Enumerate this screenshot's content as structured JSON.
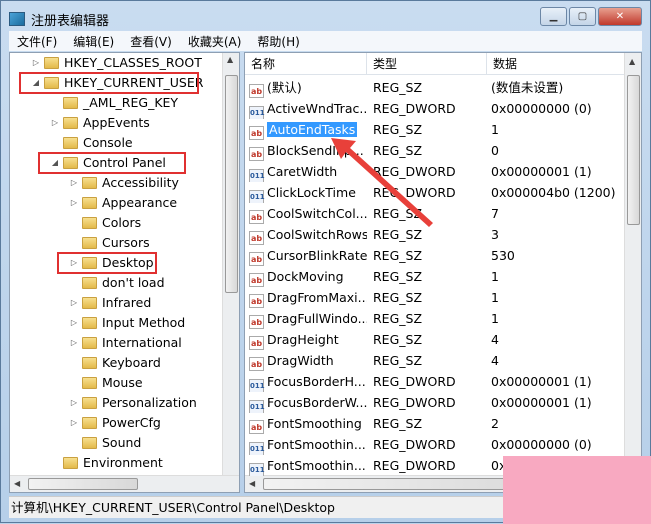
{
  "window": {
    "title": "注册表编辑器",
    "buttons": [
      "minimize",
      "maximize",
      "close"
    ]
  },
  "menu": [
    "文件(F)",
    "编辑(E)",
    "查看(V)",
    "收藏夹(A)",
    "帮助(H)"
  ],
  "tree": [
    {
      "label": "HKEY_CLASSES_ROOT",
      "level": 0,
      "expander": "collapsed"
    },
    {
      "label": "HKEY_CURRENT_USER",
      "level": 0,
      "expander": "expanded",
      "highlighted": true
    },
    {
      "label": "_AML_REG_KEY",
      "level": 1,
      "expander": "none"
    },
    {
      "label": "AppEvents",
      "level": 1,
      "expander": "collapsed"
    },
    {
      "label": "Console",
      "level": 1,
      "expander": "none"
    },
    {
      "label": "Control Panel",
      "level": 1,
      "expander": "expanded",
      "highlighted": true
    },
    {
      "label": "Accessibility",
      "level": 2,
      "expander": "collapsed"
    },
    {
      "label": "Appearance",
      "level": 2,
      "expander": "collapsed"
    },
    {
      "label": "Colors",
      "level": 2,
      "expander": "none"
    },
    {
      "label": "Cursors",
      "level": 2,
      "expander": "none"
    },
    {
      "label": "Desktop",
      "level": 2,
      "expander": "collapsed",
      "highlighted": true,
      "selected": true
    },
    {
      "label": "don't load",
      "level": 2,
      "expander": "none"
    },
    {
      "label": "Infrared",
      "level": 2,
      "expander": "collapsed"
    },
    {
      "label": "Input Method",
      "level": 2,
      "expander": "collapsed"
    },
    {
      "label": "International",
      "level": 2,
      "expander": "collapsed"
    },
    {
      "label": "Keyboard",
      "level": 2,
      "expander": "none"
    },
    {
      "label": "Mouse",
      "level": 2,
      "expander": "none"
    },
    {
      "label": "Personalization",
      "level": 2,
      "expander": "collapsed"
    },
    {
      "label": "PowerCfg",
      "level": 2,
      "expander": "collapsed"
    },
    {
      "label": "Sound",
      "level": 2,
      "expander": "none"
    },
    {
      "label": "Environment",
      "level": 1,
      "expander": "none"
    }
  ],
  "list": {
    "columns": [
      "名称",
      "类型",
      "数据"
    ],
    "rows": [
      {
        "icon": "string",
        "name": "(默认)",
        "type": "REG_SZ",
        "data": "(数值未设置)"
      },
      {
        "icon": "dword",
        "name": "ActiveWndTrac...",
        "type": "REG_DWORD",
        "data": "0x00000000 (0)"
      },
      {
        "icon": "string",
        "name": "AutoEndTasks",
        "type": "REG_SZ",
        "data": "1",
        "selected": true
      },
      {
        "icon": "string",
        "name": "BlockSendInp...",
        "type": "REG_SZ",
        "data": "0"
      },
      {
        "icon": "dword",
        "name": "CaretWidth",
        "type": "REG_DWORD",
        "data": "0x00000001 (1)"
      },
      {
        "icon": "dword",
        "name": "ClickLockTime",
        "type": "REG_DWORD",
        "data": "0x000004b0 (1200)"
      },
      {
        "icon": "string",
        "name": "CoolSwitchCol...",
        "type": "REG_SZ",
        "data": "7"
      },
      {
        "icon": "string",
        "name": "CoolSwitchRows",
        "type": "REG_SZ",
        "data": "3"
      },
      {
        "icon": "string",
        "name": "CursorBlinkRate",
        "type": "REG_SZ",
        "data": "530"
      },
      {
        "icon": "string",
        "name": "DockMoving",
        "type": "REG_SZ",
        "data": "1"
      },
      {
        "icon": "string",
        "name": "DragFromMaxi...",
        "type": "REG_SZ",
        "data": "1"
      },
      {
        "icon": "string",
        "name": "DragFullWindo...",
        "type": "REG_SZ",
        "data": "1"
      },
      {
        "icon": "string",
        "name": "DragHeight",
        "type": "REG_SZ",
        "data": "4"
      },
      {
        "icon": "string",
        "name": "DragWidth",
        "type": "REG_SZ",
        "data": "4"
      },
      {
        "icon": "dword",
        "name": "FocusBorderH...",
        "type": "REG_DWORD",
        "data": "0x00000001 (1)"
      },
      {
        "icon": "dword",
        "name": "FocusBorderW...",
        "type": "REG_DWORD",
        "data": "0x00000001 (1)"
      },
      {
        "icon": "string",
        "name": "FontSmoothing",
        "type": "REG_SZ",
        "data": "2"
      },
      {
        "icon": "dword",
        "name": "FontSmoothin...",
        "type": "REG_DWORD",
        "data": "0x00000000 (0)"
      },
      {
        "icon": "dword",
        "name": "FontSmoothin...",
        "type": "REG_DWORD",
        "data": "0x"
      }
    ]
  },
  "status_path": "计算机\\HKEY_CURRENT_USER\\Control Panel\\Desktop",
  "colors": {
    "highlight_box": "#e03030",
    "selection": "#3399ff",
    "arrow": "#e8403a"
  }
}
